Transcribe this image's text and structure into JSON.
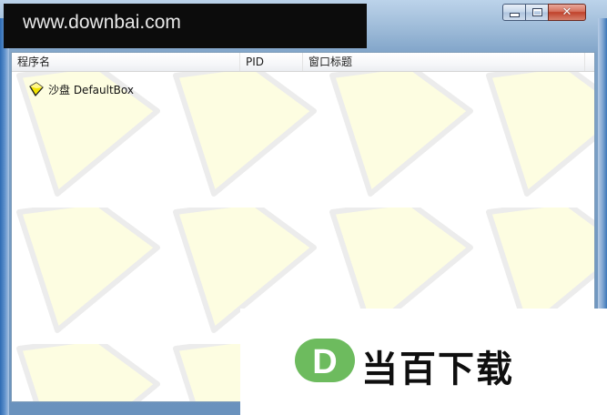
{
  "window": {
    "close_glyph": "✕"
  },
  "watermark": {
    "site_text": "www.downbai.com"
  },
  "list": {
    "columns": [
      "程序名",
      "PID",
      "窗口标题",
      ""
    ],
    "rows": [
      {
        "label": "沙盘 DefaultBox",
        "icon": "sandbox-diamond-icon",
        "icon_color": "#f2e400"
      }
    ]
  },
  "brand": {
    "logo_letter": "D",
    "logo_color": "#6dbb5e",
    "name": "当百下载"
  },
  "colors": {
    "frame_blue": "#6a92bd",
    "watermark_fill": "#fdfde1",
    "watermark_stroke": "#ececec"
  }
}
